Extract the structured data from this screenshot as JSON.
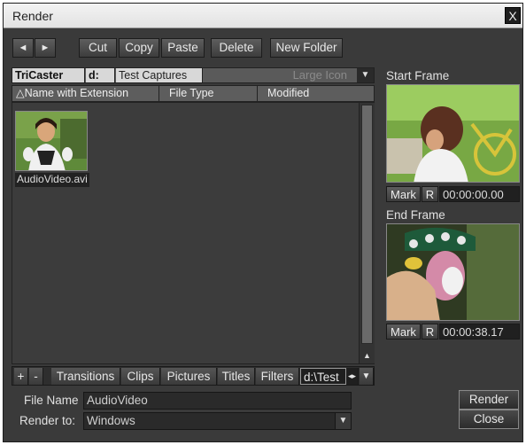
{
  "window": {
    "title": "Render",
    "close": "X"
  },
  "toolbar": {
    "back": "◄",
    "forward": "►",
    "cut": "Cut",
    "copy": "Copy",
    "paste": "Paste",
    "delete": "Delete",
    "new_folder": "New Folder"
  },
  "location": {
    "host": "TriCaster",
    "drive": "d:",
    "folder": "Test Captures",
    "view_mode": "Large Icon",
    "dropdown": "▼"
  },
  "columns": {
    "name": "Name with Extension",
    "sort_glyph": "△",
    "type": "File Type",
    "modified": "Modified"
  },
  "files": [
    {
      "name": "AudioVideo.avi"
    }
  ],
  "scroll": {
    "up": "▲"
  },
  "tabs": {
    "add": "+",
    "remove": "-",
    "items": [
      "Transitions",
      "Clips",
      "Pictures",
      "Titles",
      "Filters"
    ],
    "path": "d:\\Test",
    "arrows": "◂▸",
    "dropdown": "▼"
  },
  "form": {
    "file_name_label": "File Name",
    "file_name_value": "AudioVideo",
    "render_to_label": "Render to:",
    "render_to_value": "Windows",
    "render_to_dropdown": "▼"
  },
  "start_frame": {
    "label": "Start Frame",
    "mark": "Mark",
    "r": "R",
    "timecode": "00:00:00.00"
  },
  "end_frame": {
    "label": "End Frame",
    "mark": "Mark",
    "r": "R",
    "timecode": "00:00:38.17"
  },
  "actions": {
    "render": "Render",
    "close": "Close"
  }
}
